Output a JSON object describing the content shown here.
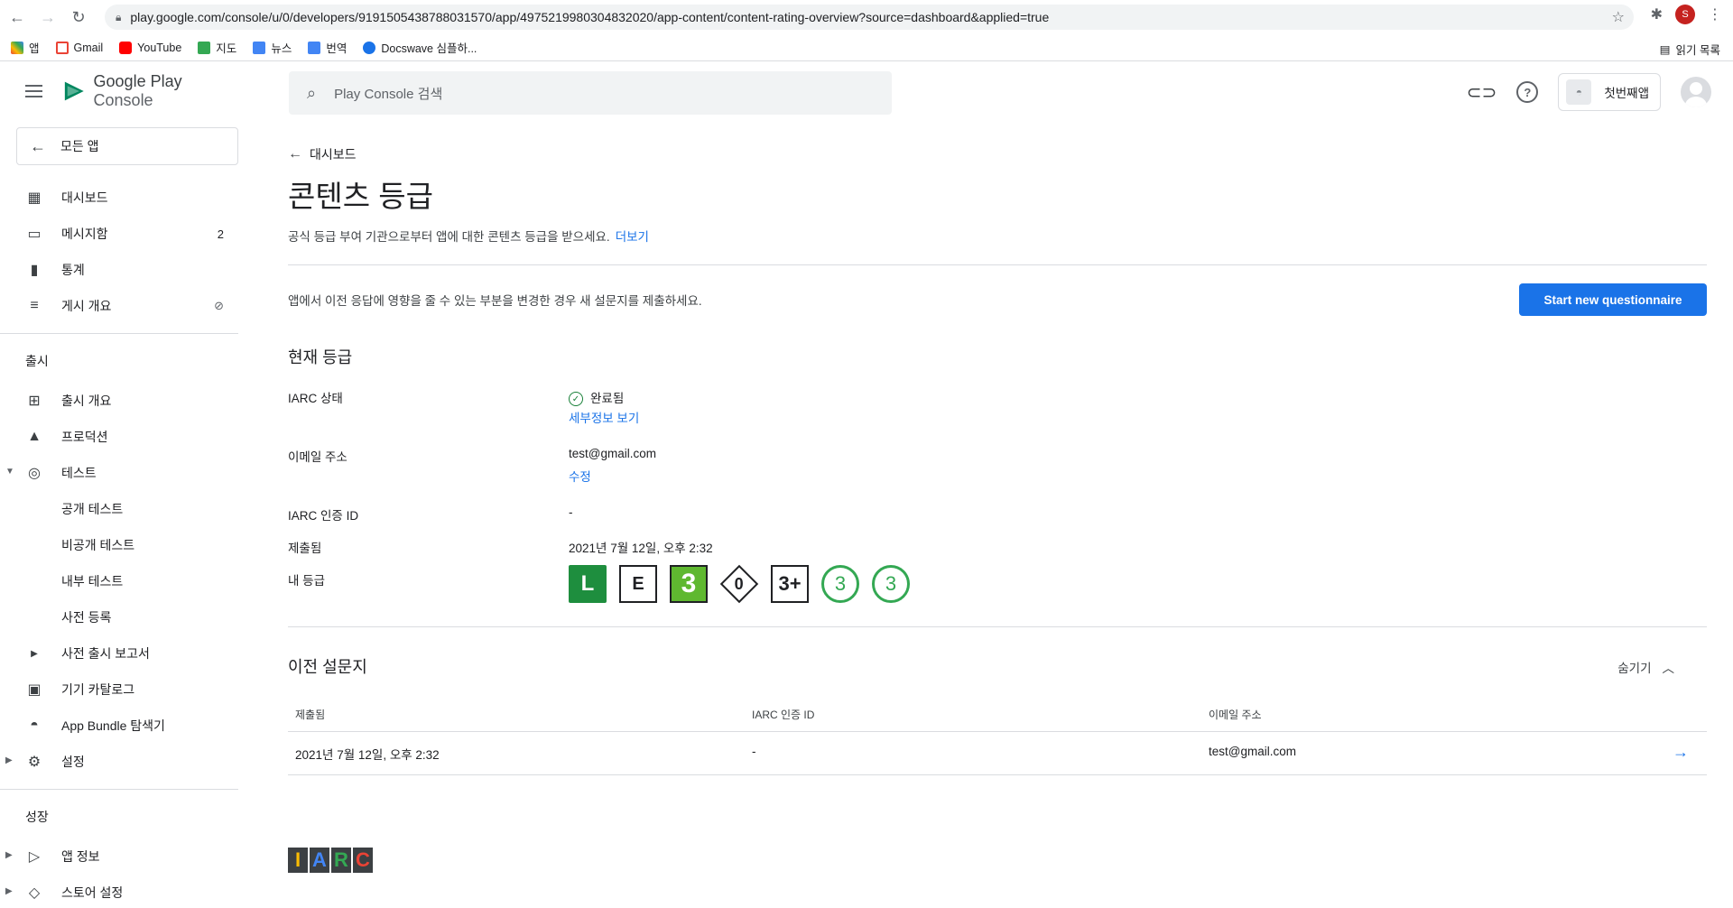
{
  "browser": {
    "url": "play.google.com/console/u/0/developers/9191505438788031570/app/4975219980304832020/app-content/content-rating-overview?source=dashboard&applied=true",
    "profile_initial": "S",
    "bookmarks": [
      "앱",
      "Gmail",
      "YouTube",
      "지도",
      "뉴스",
      "번역",
      "Docswave 심플하..."
    ],
    "reading_list": "읽기 목록"
  },
  "sidebar": {
    "brand_google": "Google Play",
    "brand_console": "Console",
    "back_label": "모든 앱",
    "items": [
      {
        "label": "대시보드",
        "icon": "dashboard-icon"
      },
      {
        "label": "메시지함",
        "icon": "inbox-icon",
        "count": "2"
      },
      {
        "label": "통계",
        "icon": "bar-chart-icon"
      },
      {
        "label": "게시 개요",
        "icon": "publish-overview-icon"
      }
    ],
    "release_section": "출시",
    "release_items": [
      {
        "label": "출시 개요"
      },
      {
        "label": "프로덕션"
      },
      {
        "label": "테스트"
      }
    ],
    "test_subitems": [
      "공개 테스트",
      "비공개 테스트",
      "내부 테스트",
      "사전 등록"
    ],
    "more_items": [
      {
        "label": "사전 출시 보고서"
      },
      {
        "label": "기기 카탈로그"
      },
      {
        "label": "App Bundle 탐색기"
      },
      {
        "label": "설정"
      }
    ],
    "growth_section": "성장",
    "growth_items": [
      {
        "label": "앱 정보"
      },
      {
        "label": "스토어 설정"
      }
    ]
  },
  "header": {
    "search_placeholder": "Play Console 검색",
    "app_name": "첫번째앱"
  },
  "page": {
    "breadcrumb": "대시보드",
    "title": "콘텐츠 등급",
    "subtitle": "공식 등급 부여 기관으로부터 앱에 대한 콘텐츠 등급을 받으세요.",
    "learn_more": "더보기",
    "notice": "앱에서 이전 응답에 영향을 줄 수 있는 부분을 변경한 경우 새 설문지를 제출하세요.",
    "start_button": "Start new questionnaire",
    "current_rating_title": "현재 등급",
    "iarc_status_label": "IARC 상태",
    "iarc_status_value": "완료됨",
    "view_details": "세부정보 보기",
    "email_label": "이메일 주소",
    "email_value": "test@gmail.com",
    "edit_link": "수정",
    "cert_id_label": "IARC 인증 ID",
    "cert_id_value": "-",
    "submitted_label": "제출됨",
    "submitted_value": "2021년 7월 12일, 오후 2:32",
    "my_rating_label": "내 등급",
    "ratings": [
      {
        "type": "ClassInd",
        "text": "L"
      },
      {
        "type": "ESRB",
        "text": "E"
      },
      {
        "type": "PEGI",
        "text": "3"
      },
      {
        "type": "USK",
        "text": "0"
      },
      {
        "type": "IARC",
        "text": "3+"
      },
      {
        "type": "Generic",
        "text": "3"
      },
      {
        "type": "Generic",
        "text": "3"
      }
    ],
    "previous_title": "이전 설문지",
    "hide_label": "숨기기",
    "table_headers": [
      "제출됨",
      "IARC 인증 ID",
      "이메일 주소"
    ],
    "table_rows": [
      {
        "submitted": "2021년 7월 12일, 오후 2:32",
        "cert_id": "-",
        "email": "test@gmail.com"
      }
    ],
    "iarc_logo": [
      "I",
      "A",
      "R",
      "C"
    ]
  },
  "colors": {
    "accent": "#1a73e8",
    "success": "#188038"
  }
}
